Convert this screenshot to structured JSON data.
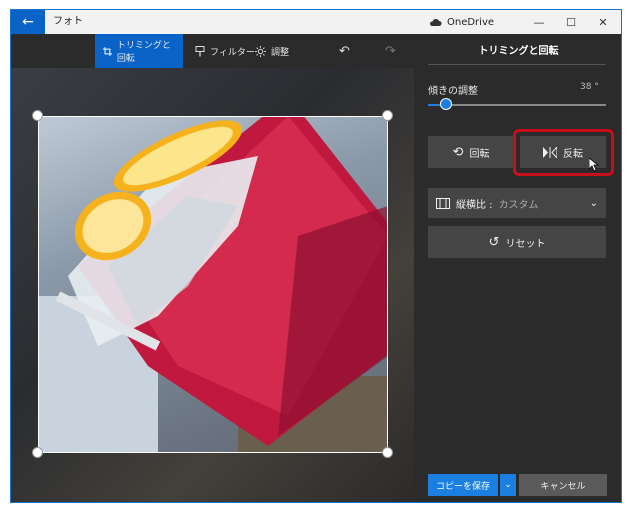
{
  "titlebar": {
    "back_icon": "arrow-left-icon",
    "app_title": "フォト",
    "onedrive_label": "OneDrive",
    "controls": [
      "—",
      "☐",
      "✕"
    ]
  },
  "toolbar": {
    "crop_label": "トリミングと回転",
    "filter_label": "フィルター",
    "adjust_label": "調整",
    "undo_icon": "undo-icon",
    "redo_icon": "redo-icon"
  },
  "panel": {
    "title": "トリミングと回転",
    "tilt_label": "傾きの調整",
    "tilt_value": "38 °",
    "tilt_fraction": 0.1,
    "rotate_label": "回転",
    "flip_label": "反転",
    "aspect_label": "縦横比 :",
    "aspect_value": "カスタム",
    "reset_label": "リセット",
    "save_copy_label": "コピーを保存",
    "cancel_label": "キャンセル"
  },
  "colors": {
    "accent": "#1a7fe0",
    "toolbar_active": "#0a64c8",
    "highlight": "#c8101c",
    "panel_bg": "#2b2b2b",
    "button_bg": "#454545"
  }
}
